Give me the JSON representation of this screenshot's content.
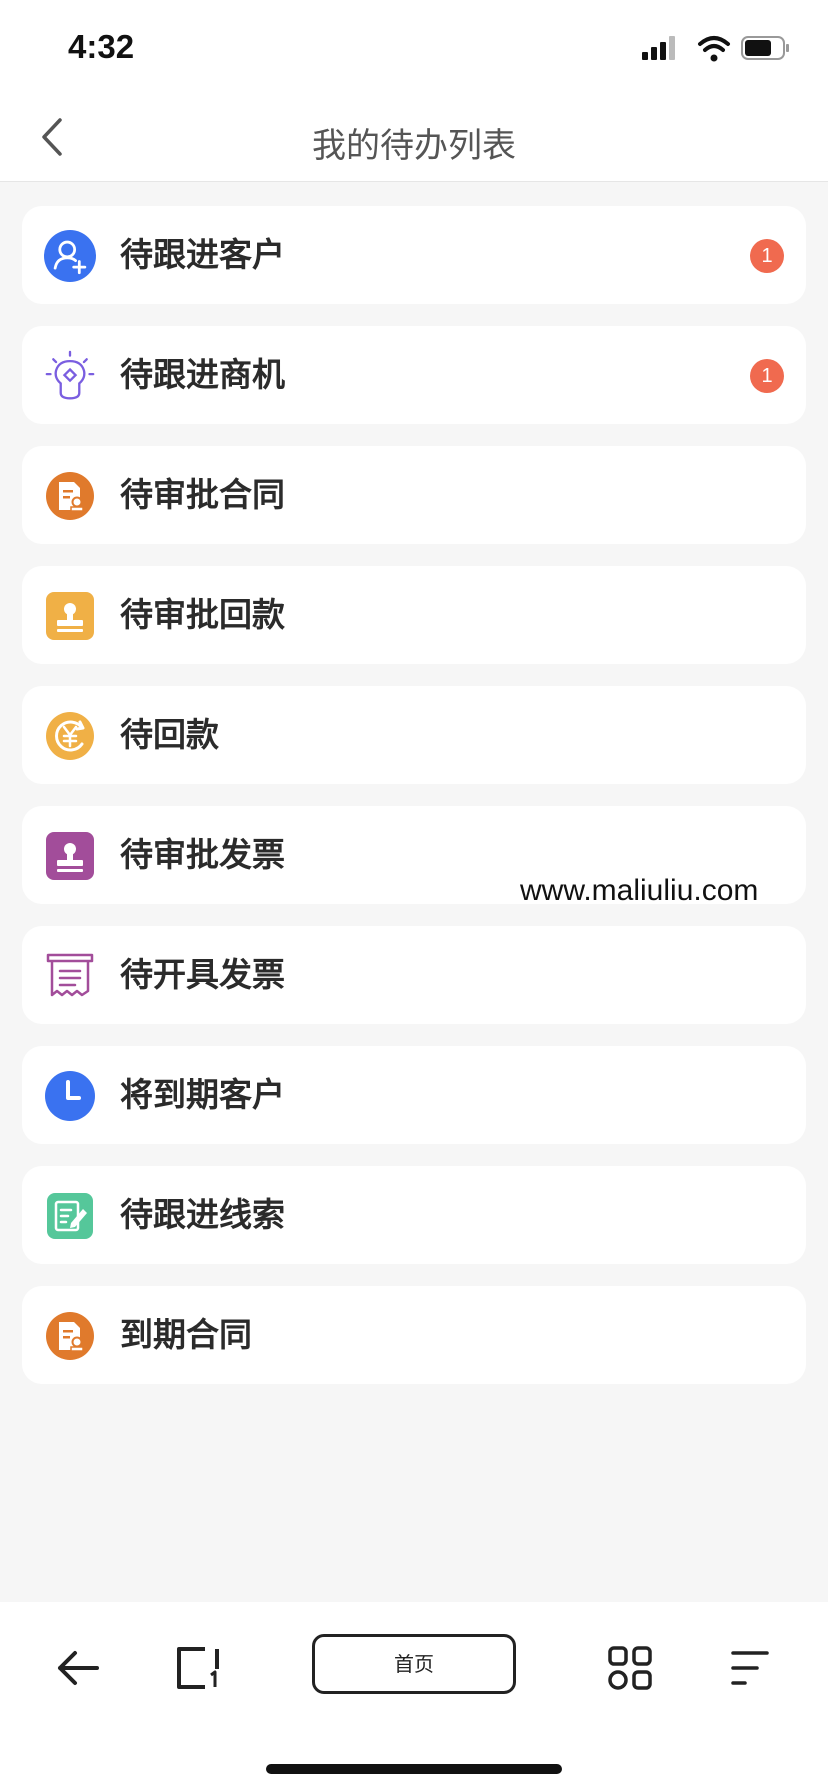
{
  "status_bar": {
    "time": "4:32"
  },
  "nav": {
    "title": "我的待办列表"
  },
  "items": [
    {
      "label": "待跟进客户",
      "icon": "user-add-icon",
      "badge": "1"
    },
    {
      "label": "待跟进商机",
      "icon": "lightbulb-icon",
      "badge": "1"
    },
    {
      "label": "待审批合同",
      "icon": "contract-icon"
    },
    {
      "label": "待审批回款",
      "icon": "stamp-icon"
    },
    {
      "label": "待回款",
      "icon": "yuan-refresh-icon"
    },
    {
      "label": "待审批发票",
      "icon": "stamp-icon"
    },
    {
      "label": "待开具发票",
      "icon": "receipt-icon"
    },
    {
      "label": "将到期客户",
      "icon": "clock-icon"
    },
    {
      "label": "待跟进线索",
      "icon": "edit-note-icon"
    },
    {
      "label": "到期合同",
      "icon": "contract-icon"
    }
  ],
  "watermark": "www.maliuliu.com",
  "bottom_bar": {
    "home_label": "首页"
  },
  "colors": {
    "blue": "#3a72f0",
    "purple": "#7a5ee0",
    "orange": "#e07a2c",
    "yellow": "#f0b046",
    "magenta": "#a24d9a",
    "green": "#55c79a",
    "badge": "#f06a4f"
  }
}
